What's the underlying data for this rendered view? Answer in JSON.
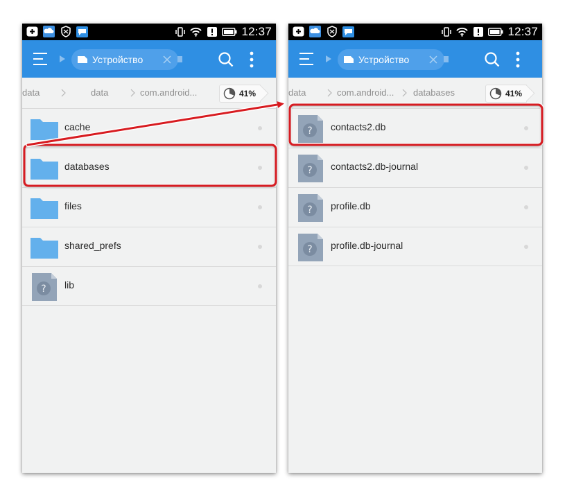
{
  "colors": {
    "toolbar": "#2f8fe3",
    "folder": "#63b0ec",
    "unknown_file": "#93a4b8",
    "highlight": "#d71b20",
    "status_bar": "#000000"
  },
  "status_bar": {
    "time": "12:37",
    "icons_left": [
      "add-box-icon",
      "weather-cloud-icon",
      "shield-icon",
      "chat-bubble-icon"
    ],
    "icons_right": [
      "vibrate-icon",
      "wifi-icon",
      "alert-icon",
      "battery-icon"
    ]
  },
  "left_panel": {
    "toolbar": {
      "tab_label": "Устройство",
      "icons": [
        "menu-icon",
        "arrow-icon",
        "device-icon",
        "close-icon",
        "search-icon",
        "more-vert-icon"
      ]
    },
    "breadcrumb": [
      "data",
      "data",
      "com.android..."
    ],
    "usage": "41%",
    "files": [
      {
        "name": "cache",
        "type": "folder",
        "highlighted": false
      },
      {
        "name": "databases",
        "type": "folder",
        "highlighted": true
      },
      {
        "name": "files",
        "type": "folder",
        "highlighted": false
      },
      {
        "name": "shared_prefs",
        "type": "folder",
        "highlighted": false
      },
      {
        "name": "lib",
        "type": "unknown",
        "highlighted": false
      }
    ]
  },
  "right_panel": {
    "toolbar": {
      "tab_label": "Устройство",
      "icons": [
        "menu-icon",
        "arrow-icon",
        "device-icon",
        "close-icon",
        "search-icon",
        "more-vert-icon"
      ]
    },
    "breadcrumb": [
      "data",
      "com.android...",
      "databases"
    ],
    "usage": "41%",
    "files": [
      {
        "name": "contacts2.db",
        "type": "unknown",
        "highlighted": true
      },
      {
        "name": "contacts2.db-journal",
        "type": "unknown",
        "highlighted": false
      },
      {
        "name": "profile.db",
        "type": "unknown",
        "highlighted": false
      },
      {
        "name": "profile.db-journal",
        "type": "unknown",
        "highlighted": false
      }
    ]
  }
}
